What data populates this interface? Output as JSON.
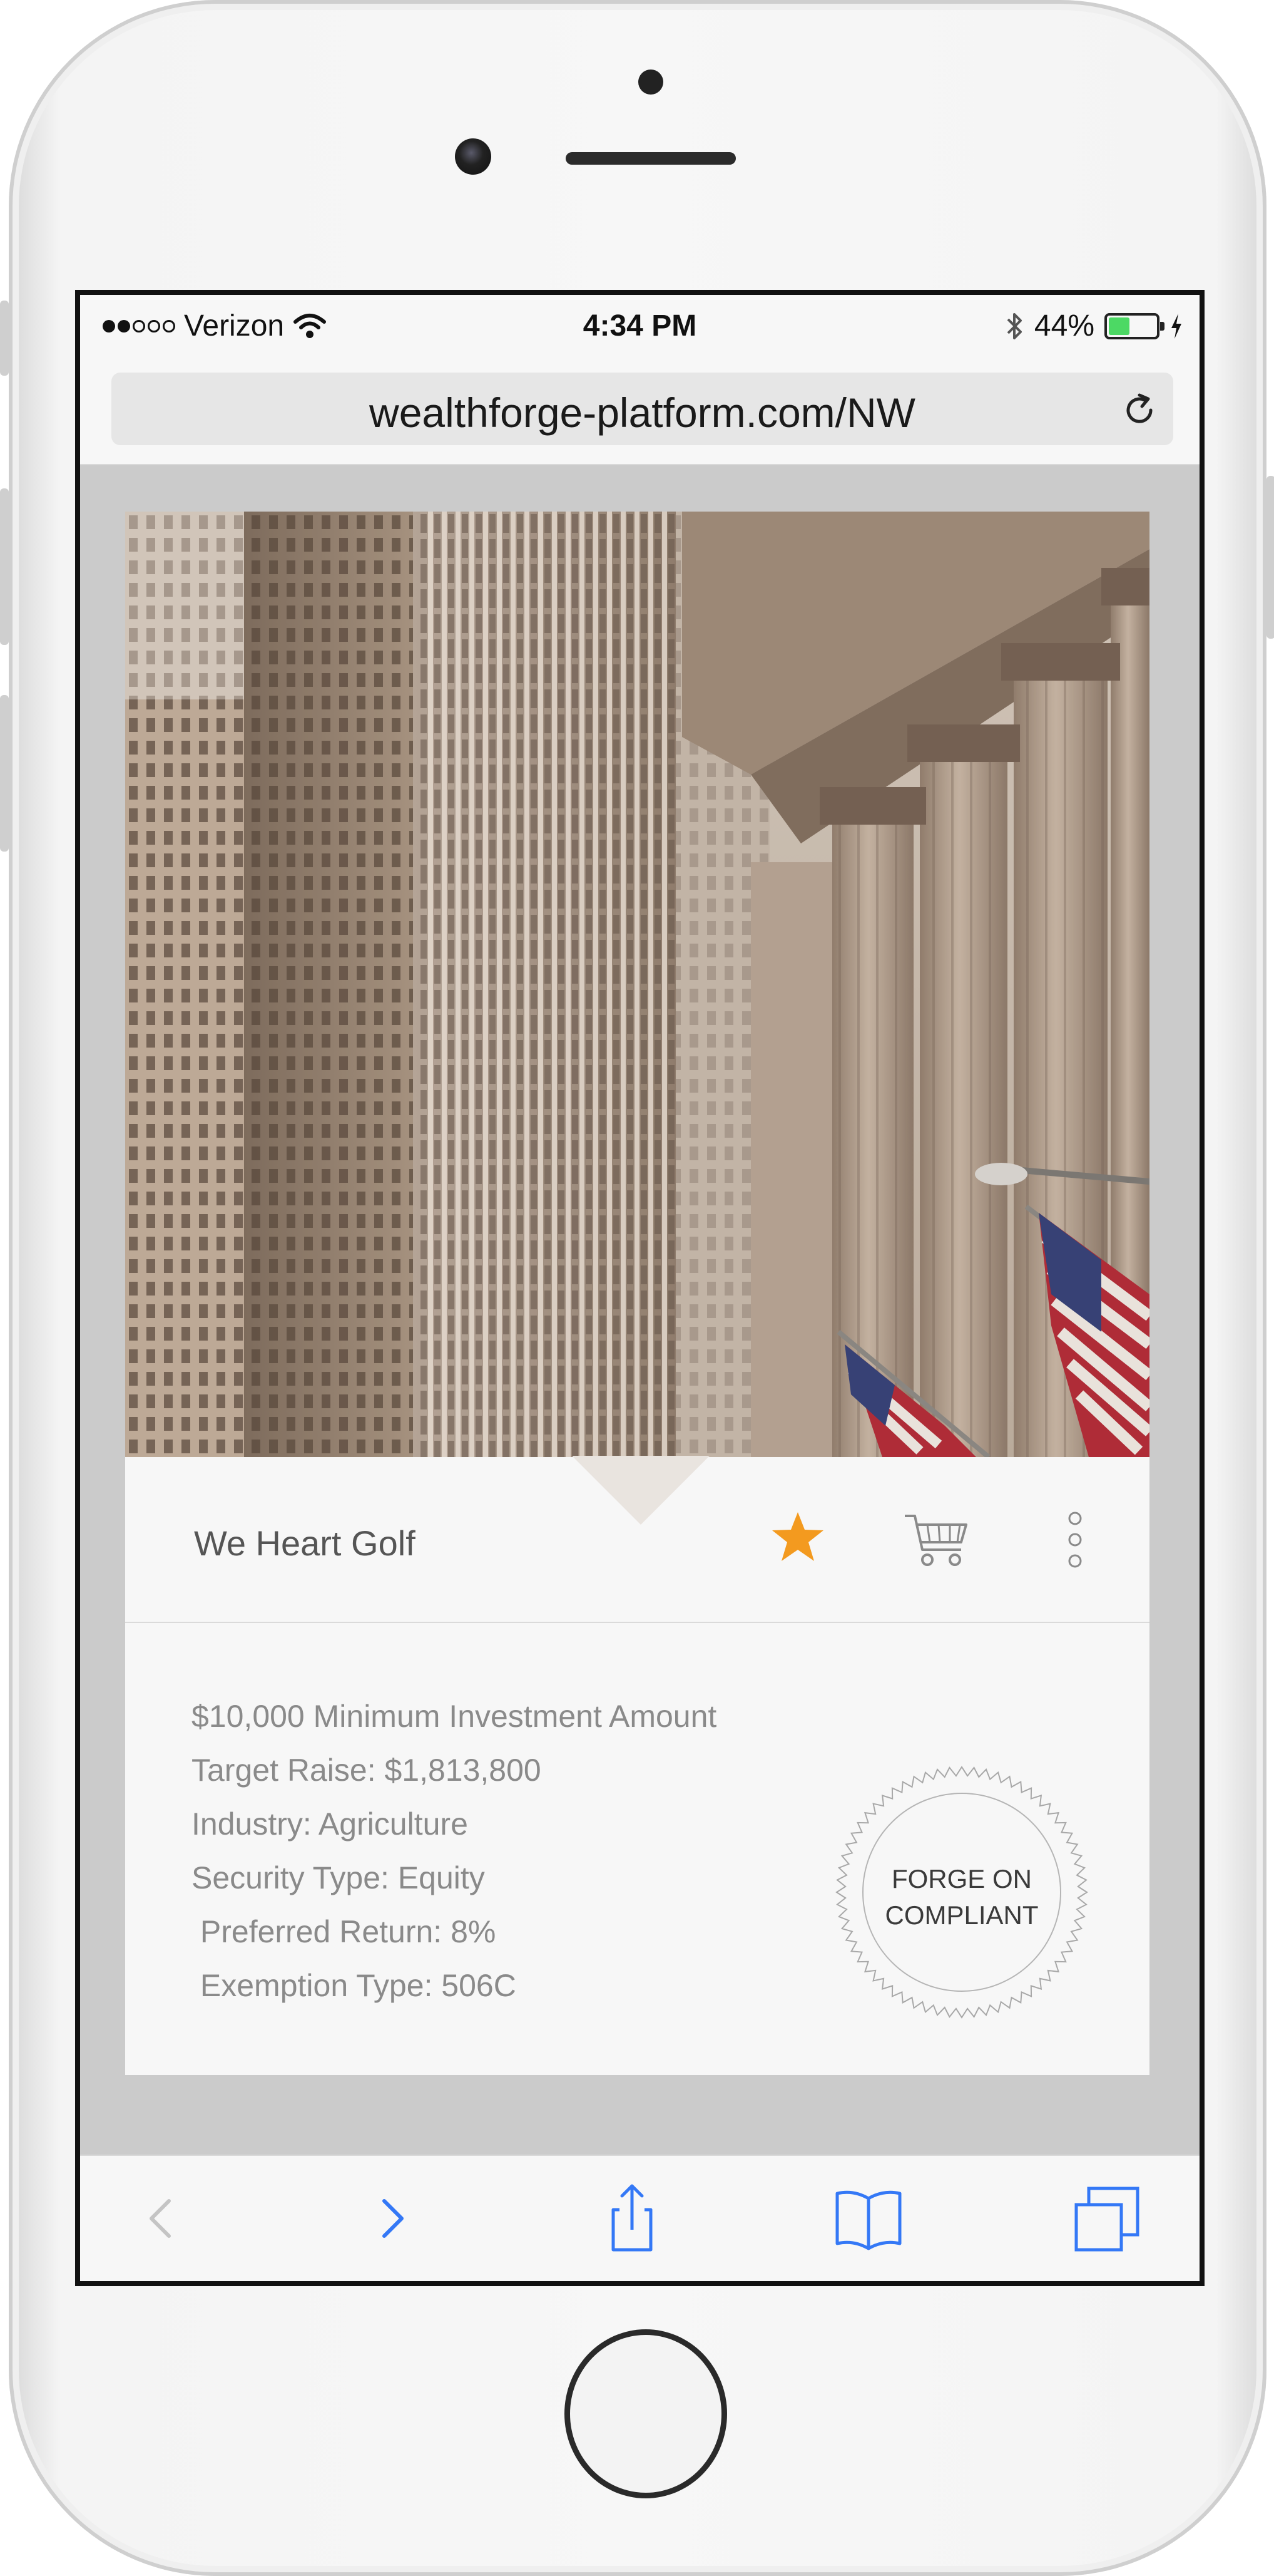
{
  "status_bar": {
    "signal_strength": 2,
    "signal_max": 5,
    "carrier": "Verizon",
    "time": "4:34 PM",
    "battery_text": "44%",
    "battery_level": 0.44,
    "battery_color": "#4cd964"
  },
  "browser": {
    "url": "wealthforge-platform.com/NW",
    "reload_icon": "reload-icon",
    "toolbar": [
      "back-icon",
      "forward-icon",
      "share-icon",
      "bookmarks-icon",
      "tabs-icon"
    ]
  },
  "offering": {
    "title": "We Heart Golf",
    "star_color": "#f39a1f",
    "details": [
      "$10,000 Minimum Investment Amount",
      "Target Raise: $1,813,800",
      "Industry: Agriculture",
      "Security Type: Equity",
      " Preferred Return: 8%",
      " Exemption Type: 506C"
    ],
    "seal_line1": "FORGE ON",
    "seal_line2": "COMPLIANT"
  },
  "colors": {
    "accent_blue": "#3478f6",
    "page_bg": "#cbcbcb"
  }
}
